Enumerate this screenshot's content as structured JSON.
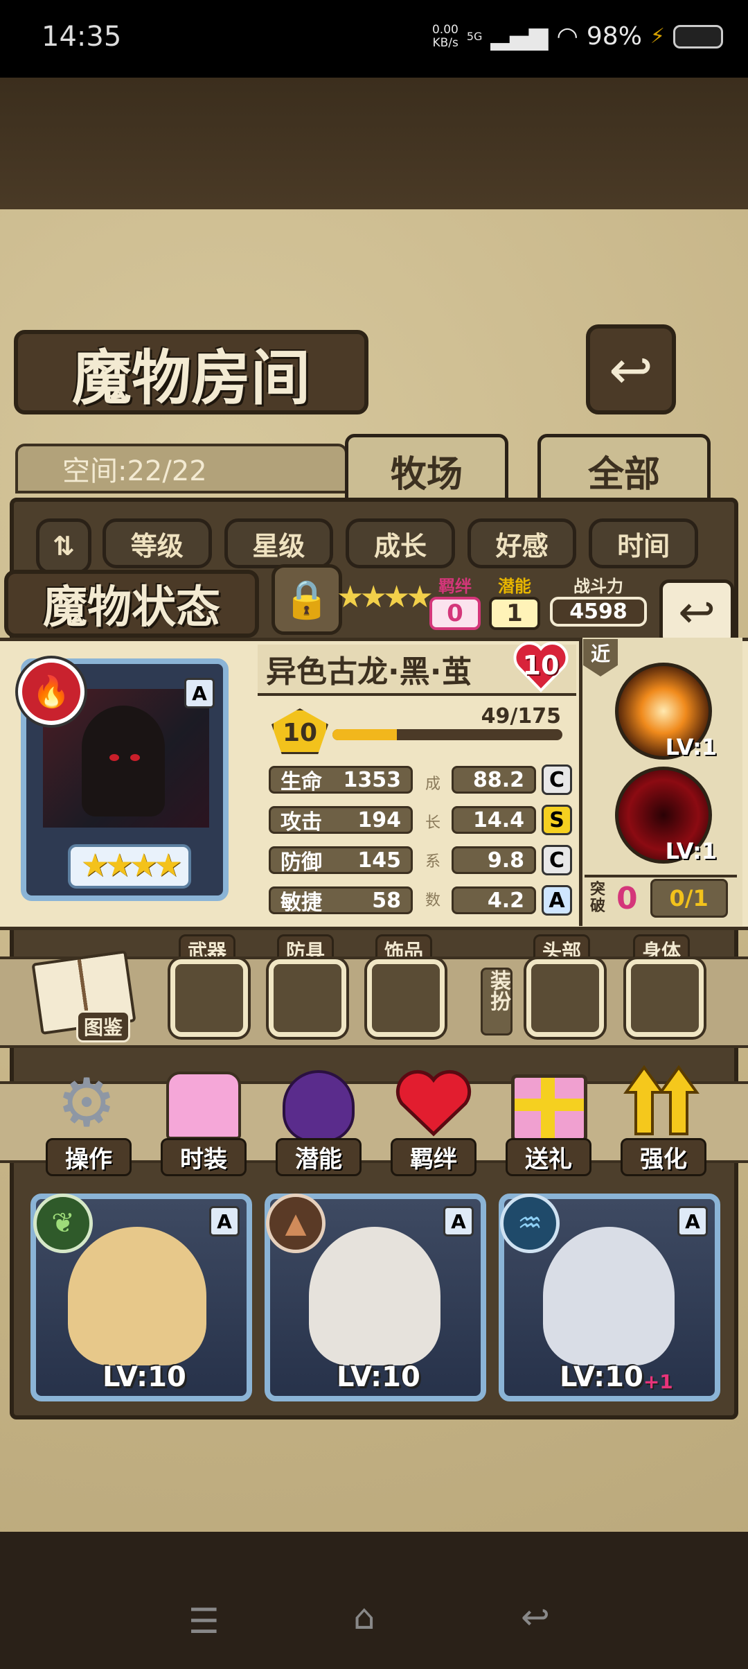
{
  "status_bar": {
    "time": "14:35",
    "net_speed_value": "0.00",
    "net_speed_unit": "KB/s",
    "network": "5G",
    "battery": "98%"
  },
  "header": {
    "title": "魔物房间"
  },
  "tabs": {
    "space": "空间:22/22",
    "ranch": "牧场",
    "all": "全部"
  },
  "sort_buttons": [
    "等级",
    "星级",
    "成长",
    "好感",
    "时间"
  ],
  "status_panel": {
    "title": "魔物状态",
    "bond_label": "羁绊",
    "bond_value": "0",
    "potential_label": "潜能",
    "potential_value": "1",
    "power_label": "战斗力",
    "power_value": "4598"
  },
  "monster": {
    "name": "异色古龙·黑·茧",
    "heart_level": "10",
    "grade": "A",
    "level": "10",
    "exp": "49/175",
    "exp_progress": 0.28,
    "stars": 4,
    "stats": [
      {
        "label": "生命",
        "value": "1353",
        "growth": "88.2",
        "grade": "C"
      },
      {
        "label": "攻击",
        "value": "194",
        "growth": "14.4",
        "grade": "S"
      },
      {
        "label": "防御",
        "value": "145",
        "growth": "9.8",
        "grade": "C"
      },
      {
        "label": "敏捷",
        "value": "58",
        "growth": "4.2",
        "grade": "A"
      }
    ],
    "growth_caption": [
      "成",
      "长",
      "系",
      "数"
    ]
  },
  "skills": {
    "range": "近",
    "skill1_lv": "LV:1",
    "skill2_lv": "LV:1",
    "breakthrough_label": "突破",
    "breakthrough_value": "0",
    "breakthrough_progress": "0/1"
  },
  "equipment": {
    "guide": "图鉴",
    "weapon": "武器",
    "armor": "防具",
    "accessory": "饰品",
    "dress": "装扮",
    "head": "头部",
    "body": "身体"
  },
  "actions": [
    "操作",
    "时装",
    "潜能",
    "羁绊",
    "送礼",
    "强化"
  ],
  "cards": [
    {
      "grade": "A",
      "level": "LV:10",
      "plus": ""
    },
    {
      "grade": "A",
      "level": "LV:10",
      "plus": ""
    },
    {
      "grade": "A",
      "level": "LV:10",
      "plus": "+1"
    }
  ],
  "colors": {
    "grade_S": "#f5d020",
    "grade_C": "#e8e8e8",
    "grade_A": "#cfe6ff",
    "parchment": "#efe4c3",
    "wood": "#4b3a27"
  }
}
